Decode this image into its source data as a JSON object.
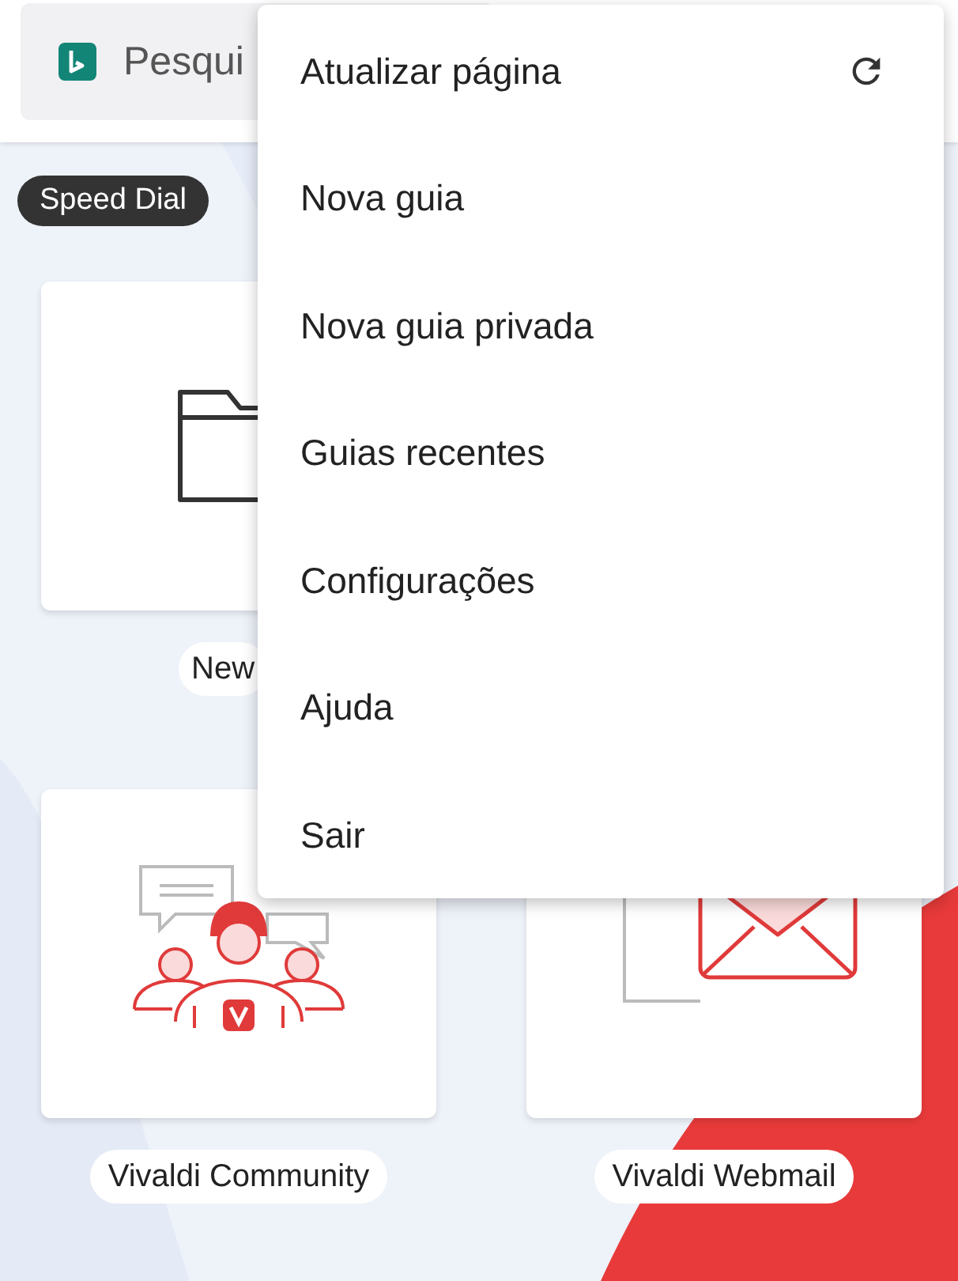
{
  "search": {
    "placeholder": "Pesqui"
  },
  "section_label": "Speed Dial",
  "rows": [
    [
      {
        "label": "New",
        "kind": "folder"
      }
    ],
    [
      {
        "label": "Vivaldi Community",
        "kind": "community"
      },
      {
        "label": "Vivaldi Webmail",
        "kind": "webmail"
      }
    ]
  ],
  "menu": [
    {
      "label": "Atualizar página",
      "kind": "refresh"
    },
    {
      "label": "Nova guia",
      "kind": "plain"
    },
    {
      "label": "Nova guia privada",
      "kind": "plain"
    },
    {
      "label": "Guias recentes",
      "kind": "plain"
    },
    {
      "label": "Configurações",
      "kind": "plain"
    },
    {
      "label": "Ajuda",
      "kind": "plain"
    },
    {
      "label": "Sair",
      "kind": "plain"
    }
  ]
}
